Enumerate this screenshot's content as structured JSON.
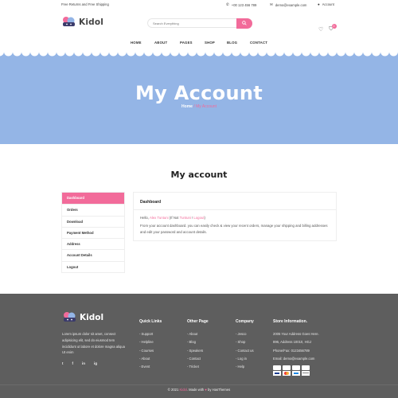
{
  "topbar": {
    "shipping": "Free Returns and Free Shipping",
    "phone": "+00 123 456 789",
    "email": "demo@example.com",
    "account": "Account"
  },
  "header": {
    "brand": "Kidol",
    "search_placeholder": "Search Everything",
    "cart_count": "0"
  },
  "nav": [
    "HOME",
    "ABOUT",
    "PAGES",
    "SHOP",
    "BLOG",
    "CONTACT"
  ],
  "banner": {
    "title": "My Account",
    "crumb_home": "Home",
    "crumb_sep": " / ",
    "crumb_current": "My Account"
  },
  "account": {
    "title": "My account",
    "menu": [
      "Dashboard",
      "Orders",
      "Download",
      "Payment Method",
      "Address",
      "Account Details",
      "Logout"
    ],
    "panel_title": "Dashboard",
    "hello_prefix": "Hello, ",
    "hello_name": "Alex Tuntuni",
    "hello_mid": " (If Not ",
    "hello_name2": "Tuntuni",
    "hello_excl": " !",
    "hello_logout": " Logout",
    "hello_suffix": ")",
    "body": "From your account dashboard. you can easily check & view your recent orders, manage your shipping and billing addresses and edit your password and account details."
  },
  "footer": {
    "brand": "Kidol",
    "about": "Lorem ipsum dolor sit amet, consect adipisicing elit, sed do eiusmod tem incididunt ut labore et dolore magna aliqua Ut enim",
    "social": [
      "t",
      "f",
      "in",
      "ig"
    ],
    "quick_links": {
      "title": "Quick Links",
      "items": [
        "- Support",
        "- Helpline",
        "- Courses",
        "- About",
        "- Event"
      ]
    },
    "other_page": {
      "title": "Other Page",
      "items": [
        "- About",
        "- Blog",
        "- Speakers",
        "- Contact",
        "- Tricket"
      ]
    },
    "company": {
      "title": "Company",
      "items": [
        "- Jesco",
        "- Shop",
        "- Contact us",
        "- Log in",
        "- Help"
      ]
    },
    "store": {
      "title": "Store Information.",
      "items": [
        "2005 Your Address Goes Here.",
        "896, Address 10010, HGJ",
        "Phone/Fax: 0123456789",
        "Email: demo@example.com"
      ]
    },
    "copyright_prefix": "© 2021 ",
    "copyright_brand": "Kidol",
    "copyright_mid": ". Made with ",
    "copyright_suffix": " by HasThemes"
  },
  "colors": {
    "accent": "#f26b9a",
    "banner": "#94b5e6",
    "footer": "#5e5e5e"
  }
}
